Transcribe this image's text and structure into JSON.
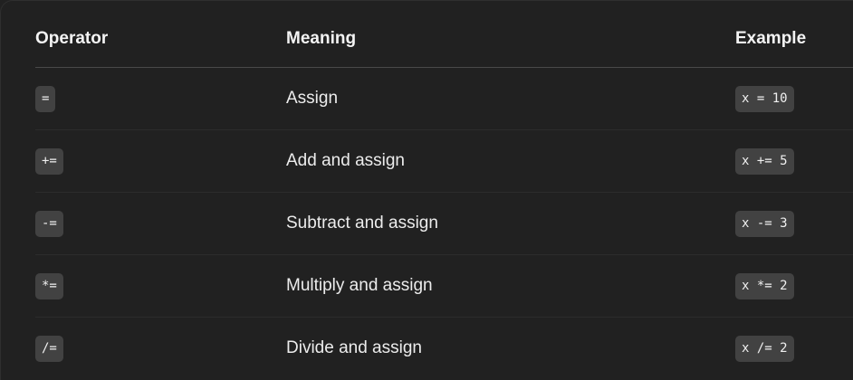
{
  "table": {
    "headers": {
      "operator": "Operator",
      "meaning": "Meaning",
      "example": "Example"
    },
    "rows": [
      {
        "operator": "=",
        "meaning": "Assign",
        "example": "x = 10"
      },
      {
        "operator": "+=",
        "meaning": "Add and assign",
        "example": "x += 5"
      },
      {
        "operator": "-=",
        "meaning": "Subtract and assign",
        "example": "x -= 3"
      },
      {
        "operator": "*=",
        "meaning": "Multiply and assign",
        "example": "x *= 2"
      },
      {
        "operator": "/=",
        "meaning": "Divide and assign",
        "example": "x /= 2"
      }
    ]
  },
  "colors": {
    "background": "#212121",
    "code_background": "#424242",
    "text": "#ececec",
    "header_divider": "#4a4a4a",
    "row_divider": "#2c2c2c"
  }
}
